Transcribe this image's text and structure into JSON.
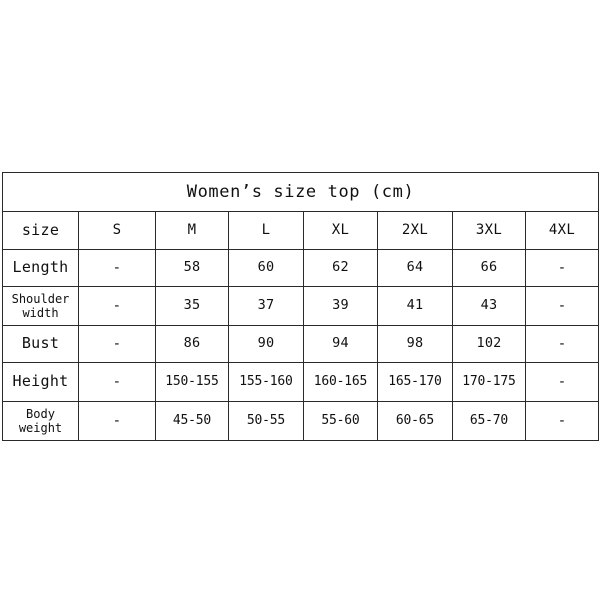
{
  "chart_data": {
    "type": "table",
    "title": "Women’s size top (cm)",
    "unit": "cm",
    "columns": [
      "size",
      "S",
      "M",
      "L",
      "XL",
      "2XL",
      "3XL",
      "4XL"
    ],
    "row_labels": [
      "Length",
      "Shoulder width",
      "Bust",
      "Height",
      "Body weight"
    ],
    "empty_marker": "-",
    "rows": [
      {
        "label": "Length",
        "label_lines": [
          "Length"
        ],
        "values": [
          "-",
          "58",
          "60",
          "62",
          "64",
          "66",
          "-"
        ]
      },
      {
        "label": "Shoulder width",
        "label_lines": [
          "Shoulder",
          "width"
        ],
        "values": [
          "-",
          "35",
          "37",
          "39",
          "41",
          "43",
          "-"
        ]
      },
      {
        "label": "Bust",
        "label_lines": [
          "Bust"
        ],
        "values": [
          "-",
          "86",
          "90",
          "94",
          "98",
          "102",
          "-"
        ]
      },
      {
        "label": "Height",
        "label_lines": [
          "Height"
        ],
        "values": [
          "-",
          "150-155",
          "155-160",
          "160-165",
          "165-170",
          "170-175",
          "-"
        ]
      },
      {
        "label": "Body weight",
        "label_lines": [
          "Body",
          "weight"
        ],
        "values": [
          "-",
          "45-50",
          "50-55",
          "55-60",
          "60-65",
          "65-70",
          "-"
        ]
      }
    ]
  },
  "table": {
    "title": "Women’s size top (cm)",
    "header": {
      "label": "size",
      "sizes": [
        "S",
        "M",
        "L",
        "XL",
        "2XL",
        "3XL",
        "4XL"
      ]
    },
    "rows": [
      {
        "label_line1": "Length",
        "label_line2": "",
        "v_s": "-",
        "v_m": "58",
        "v_l": "60",
        "v_xl": "62",
        "v_2xl": "64",
        "v_3xl": "66",
        "v_4xl": "-"
      },
      {
        "label_line1": "Shoulder",
        "label_line2": "width",
        "v_s": "-",
        "v_m": "35",
        "v_l": "37",
        "v_xl": "39",
        "v_2xl": "41",
        "v_3xl": "43",
        "v_4xl": "-"
      },
      {
        "label_line1": "Bust",
        "label_line2": "",
        "v_s": "-",
        "v_m": "86",
        "v_l": "90",
        "v_xl": "94",
        "v_2xl": "98",
        "v_3xl": "102",
        "v_4xl": "-"
      },
      {
        "label_line1": "Height",
        "label_line2": "",
        "v_s": "-",
        "v_m": "150-155",
        "v_l": "155-160",
        "v_xl": "160-165",
        "v_2xl": "165-170",
        "v_3xl": "170-175",
        "v_4xl": "-"
      },
      {
        "label_line1": "Body",
        "label_line2": "weight",
        "v_s": "-",
        "v_m": "45-50",
        "v_l": "50-55",
        "v_xl": "55-60",
        "v_2xl": "60-65",
        "v_3xl": "65-70",
        "v_4xl": "-"
      }
    ]
  },
  "colors": {
    "background": "#ffffff",
    "border": "#2a2a2a",
    "text": "#101010"
  }
}
